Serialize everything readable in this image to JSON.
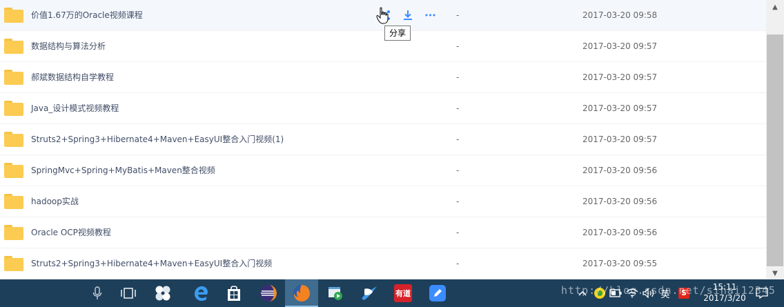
{
  "files": [
    {
      "name": "价值1.67万的Oracle视频课程",
      "size": "-",
      "modified": "2017-03-20 09:58"
    },
    {
      "name": "数据结构与算法分析",
      "size": "-",
      "modified": "2017-03-20 09:57"
    },
    {
      "name": "郝斌数据结构自学教程",
      "size": "-",
      "modified": "2017-03-20 09:57"
    },
    {
      "name": "Java_设计模式视频教程",
      "size": "-",
      "modified": "2017-03-20 09:57"
    },
    {
      "name": "Struts2+Spring3+Hibernate4+Maven+EasyUI整合入门视频(1)",
      "size": "-",
      "modified": "2017-03-20 09:57"
    },
    {
      "name": "SpringMvc+Spring+MyBatis+Maven整合视频",
      "size": "-",
      "modified": "2017-03-20 09:56"
    },
    {
      "name": "hadoop实战",
      "size": "-",
      "modified": "2017-03-20 09:56"
    },
    {
      "name": "Oracle OCP视频教程",
      "size": "-",
      "modified": "2017-03-20 09:56"
    },
    {
      "name": "Struts2+Spring3+Hibernate4+Maven+EasyUI整合入门视频",
      "size": "-",
      "modified": "2017-03-20 09:55"
    }
  ],
  "row_actions": {
    "share_tooltip": "分享",
    "more_label": "•••"
  },
  "taskbar": {
    "ime_label": "英",
    "sogou_label": "S",
    "youdao_label": "有道",
    "time": "15:11",
    "date": "2017/3/20"
  },
  "watermark": "http://blog.csdn.net/sihai12345",
  "colors": {
    "accent": "#3b8cff",
    "folder": "#fbcb52",
    "taskbar": "#1e3f5a"
  }
}
